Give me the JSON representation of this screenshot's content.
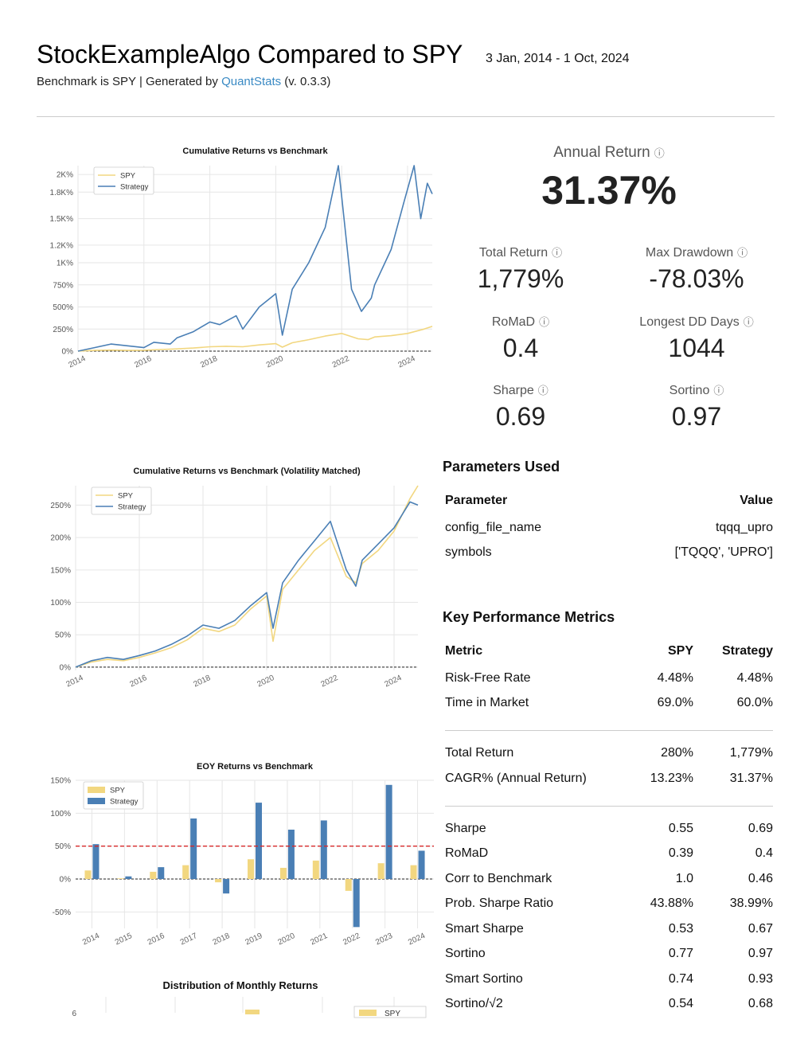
{
  "header": {
    "title": "StockExampleAlgo Compared to SPY",
    "date_range": "3 Jan, 2014 - 1 Oct, 2024",
    "subtitle_prefix": "Benchmark is SPY | Generated by ",
    "subtitle_link": "QuantStats",
    "subtitle_suffix": " (v. 0.3.3)"
  },
  "kpis": {
    "annual_return": {
      "label": "Annual Return",
      "value": "31.37%"
    },
    "total_return": {
      "label": "Total Return",
      "value": "1,779%"
    },
    "max_drawdown": {
      "label": "Max Drawdown",
      "value": "-78.03%"
    },
    "romad": {
      "label": "RoMaD",
      "value": "0.4"
    },
    "longest_dd_days": {
      "label": "Longest DD Days",
      "value": "1044"
    },
    "sharpe": {
      "label": "Sharpe",
      "value": "0.69"
    },
    "sortino": {
      "label": "Sortino",
      "value": "0.97"
    },
    "info_icon": "info-circle-icon"
  },
  "parameters": {
    "title": "Parameters Used",
    "headers": [
      "Parameter",
      "Value"
    ],
    "rows": [
      [
        "config_file_name",
        "tqqq_upro"
      ],
      [
        "symbols",
        "['TQQQ', 'UPRO']"
      ]
    ]
  },
  "metrics": {
    "title": "Key Performance Metrics",
    "headers": [
      "Metric",
      "SPY",
      "Strategy"
    ],
    "group1": [
      [
        "Risk-Free Rate",
        "4.48%",
        "4.48%"
      ],
      [
        "Time in Market",
        "69.0%",
        "60.0%"
      ]
    ],
    "group2": [
      [
        "Total Return",
        "280%",
        "1,779%"
      ],
      [
        "CAGR% (Annual Return)",
        "13.23%",
        "31.37%"
      ]
    ],
    "group3": [
      [
        "Sharpe",
        "0.55",
        "0.69"
      ],
      [
        "RoMaD",
        "0.39",
        "0.4"
      ],
      [
        "Corr to Benchmark",
        "1.0",
        "0.46"
      ],
      [
        "Prob. Sharpe Ratio",
        "43.88%",
        "38.99%"
      ],
      [
        "Smart Sharpe",
        "0.53",
        "0.67"
      ],
      [
        "Sortino",
        "0.77",
        "0.97"
      ],
      [
        "Smart Sortino",
        "0.74",
        "0.93"
      ],
      [
        "Sortino/√2",
        "0.54",
        "0.68"
      ]
    ]
  },
  "colors": {
    "spy": "#f2d780",
    "strategy": "#4a7fb5",
    "dashed_red": "#d62728"
  },
  "chart_data": [
    {
      "type": "line",
      "title": "Cumulative Returns vs Benchmark",
      "legend": [
        "SPY",
        "Strategy"
      ],
      "legend_position": "top-left",
      "x_ticks": [
        "2014",
        "2016",
        "2018",
        "2020",
        "2022",
        "2024"
      ],
      "y_ticks": [
        "0%",
        "250%",
        "500%",
        "750%",
        "1K%",
        "1.2K%",
        "1.5K%",
        "1.8K%",
        "2K%"
      ],
      "ylim": [
        0,
        2100
      ],
      "xlim": [
        2014,
        2024.75
      ],
      "series": [
        {
          "name": "SPY",
          "x": [
            2014,
            2014.5,
            2015,
            2015.5,
            2016,
            2016.5,
            2017,
            2017.5,
            2018,
            2018.5,
            2019,
            2019.5,
            2020,
            2020.2,
            2020.5,
            2021,
            2021.5,
            2022,
            2022.5,
            2022.8,
            2023,
            2023.5,
            2024,
            2024.5,
            2024.75
          ],
          "y": [
            0,
            8,
            12,
            8,
            10,
            18,
            25,
            35,
            50,
            55,
            50,
            70,
            85,
            45,
            95,
            130,
            170,
            200,
            140,
            130,
            160,
            175,
            200,
            250,
            280
          ]
        },
        {
          "name": "Strategy",
          "x": [
            2014,
            2014.5,
            2015,
            2015.5,
            2016,
            2016.3,
            2016.8,
            2017,
            2017.5,
            2018,
            2018.3,
            2018.8,
            2019,
            2019.5,
            2020,
            2020.2,
            2020.5,
            2021,
            2021.5,
            2021.9,
            2022,
            2022.3,
            2022.6,
            2022.9,
            2023,
            2023.5,
            2023.9,
            2024.2,
            2024.4,
            2024.6,
            2024.75
          ],
          "y": [
            0,
            40,
            80,
            60,
            40,
            100,
            80,
            150,
            220,
            330,
            300,
            400,
            250,
            500,
            650,
            180,
            700,
            1000,
            1400,
            2100,
            1750,
            700,
            450,
            600,
            750,
            1150,
            1700,
            2100,
            1500,
            1900,
            1779
          ]
        }
      ]
    },
    {
      "type": "line",
      "title": "Cumulative Returns vs Benchmark (Volatility Matched)",
      "legend": [
        "SPY",
        "Strategy"
      ],
      "legend_position": "top-left",
      "x_ticks": [
        "2014",
        "2016",
        "2018",
        "2020",
        "2022",
        "2024"
      ],
      "y_ticks": [
        "0%",
        "50%",
        "100%",
        "150%",
        "200%",
        "250%"
      ],
      "ylim": [
        -5,
        280
      ],
      "xlim": [
        2014,
        2024.75
      ],
      "series": [
        {
          "name": "SPY",
          "x": [
            2014,
            2014.5,
            2015,
            2015.5,
            2016,
            2016.5,
            2017,
            2017.5,
            2018,
            2018.5,
            2019,
            2019.5,
            2020,
            2020.2,
            2020.5,
            2021,
            2021.5,
            2022,
            2022.5,
            2022.8,
            2023,
            2023.5,
            2024,
            2024.5,
            2024.75
          ],
          "y": [
            0,
            8,
            12,
            10,
            15,
            22,
            30,
            42,
            60,
            55,
            65,
            90,
            110,
            40,
            120,
            150,
            180,
            200,
            140,
            130,
            160,
            180,
            210,
            260,
            280
          ]
        },
        {
          "name": "Strategy",
          "x": [
            2014,
            2014.5,
            2015,
            2015.5,
            2016,
            2016.5,
            2017,
            2017.5,
            2018,
            2018.5,
            2019,
            2019.5,
            2020,
            2020.2,
            2020.5,
            2021,
            2021.5,
            2022,
            2022.5,
            2022.8,
            2023,
            2023.5,
            2024,
            2024.5,
            2024.75
          ],
          "y": [
            0,
            10,
            15,
            12,
            18,
            25,
            35,
            48,
            65,
            60,
            72,
            95,
            115,
            60,
            130,
            165,
            195,
            225,
            150,
            125,
            165,
            190,
            215,
            255,
            250
          ]
        }
      ]
    },
    {
      "type": "bar",
      "title": "EOY Returns  vs Benchmark",
      "legend": [
        "SPY",
        "Strategy"
      ],
      "legend_position": "top-left",
      "categories": [
        "2014",
        "2015",
        "2016",
        "2017",
        "2018",
        "2019",
        "2020",
        "2021",
        "2022",
        "2023",
        "2024"
      ],
      "y_ticks": [
        "-50%",
        "0%",
        "50%",
        "100%",
        "150%"
      ],
      "ylim": [
        -75,
        150
      ],
      "reference_line": 50,
      "series": [
        {
          "name": "SPY",
          "values": [
            13,
            1,
            11,
            21,
            -5,
            30,
            17,
            28,
            -18,
            24,
            21
          ]
        },
        {
          "name": "Strategy",
          "values": [
            53,
            4,
            18,
            92,
            -22,
            116,
            75,
            89,
            -73,
            143,
            43
          ]
        }
      ]
    },
    {
      "type": "bar",
      "title": "Distribution of Monthly Returns",
      "legend": [
        "SPY"
      ],
      "legend_position": "top-right",
      "y_ticks": [
        "6"
      ],
      "series": []
    }
  ]
}
